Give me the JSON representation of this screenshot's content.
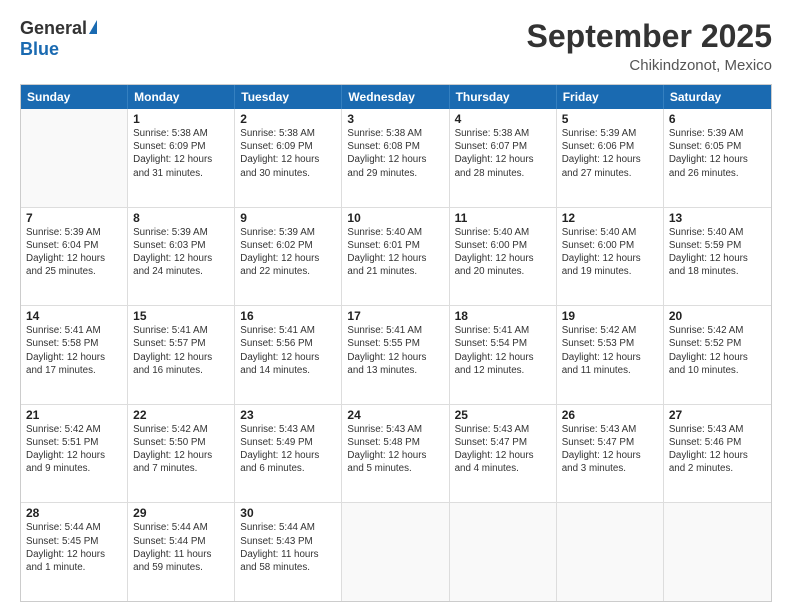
{
  "header": {
    "logo_general": "General",
    "logo_blue": "Blue",
    "month": "September 2025",
    "location": "Chikindzonot, Mexico"
  },
  "calendar": {
    "days_of_week": [
      "Sunday",
      "Monday",
      "Tuesday",
      "Wednesday",
      "Thursday",
      "Friday",
      "Saturday"
    ],
    "rows": [
      [
        {
          "day": "",
          "info": ""
        },
        {
          "day": "1",
          "info": "Sunrise: 5:38 AM\nSunset: 6:09 PM\nDaylight: 12 hours\nand 31 minutes."
        },
        {
          "day": "2",
          "info": "Sunrise: 5:38 AM\nSunset: 6:09 PM\nDaylight: 12 hours\nand 30 minutes."
        },
        {
          "day": "3",
          "info": "Sunrise: 5:38 AM\nSunset: 6:08 PM\nDaylight: 12 hours\nand 29 minutes."
        },
        {
          "day": "4",
          "info": "Sunrise: 5:38 AM\nSunset: 6:07 PM\nDaylight: 12 hours\nand 28 minutes."
        },
        {
          "day": "5",
          "info": "Sunrise: 5:39 AM\nSunset: 6:06 PM\nDaylight: 12 hours\nand 27 minutes."
        },
        {
          "day": "6",
          "info": "Sunrise: 5:39 AM\nSunset: 6:05 PM\nDaylight: 12 hours\nand 26 minutes."
        }
      ],
      [
        {
          "day": "7",
          "info": "Sunrise: 5:39 AM\nSunset: 6:04 PM\nDaylight: 12 hours\nand 25 minutes."
        },
        {
          "day": "8",
          "info": "Sunrise: 5:39 AM\nSunset: 6:03 PM\nDaylight: 12 hours\nand 24 minutes."
        },
        {
          "day": "9",
          "info": "Sunrise: 5:39 AM\nSunset: 6:02 PM\nDaylight: 12 hours\nand 22 minutes."
        },
        {
          "day": "10",
          "info": "Sunrise: 5:40 AM\nSunset: 6:01 PM\nDaylight: 12 hours\nand 21 minutes."
        },
        {
          "day": "11",
          "info": "Sunrise: 5:40 AM\nSunset: 6:00 PM\nDaylight: 12 hours\nand 20 minutes."
        },
        {
          "day": "12",
          "info": "Sunrise: 5:40 AM\nSunset: 6:00 PM\nDaylight: 12 hours\nand 19 minutes."
        },
        {
          "day": "13",
          "info": "Sunrise: 5:40 AM\nSunset: 5:59 PM\nDaylight: 12 hours\nand 18 minutes."
        }
      ],
      [
        {
          "day": "14",
          "info": "Sunrise: 5:41 AM\nSunset: 5:58 PM\nDaylight: 12 hours\nand 17 minutes."
        },
        {
          "day": "15",
          "info": "Sunrise: 5:41 AM\nSunset: 5:57 PM\nDaylight: 12 hours\nand 16 minutes."
        },
        {
          "day": "16",
          "info": "Sunrise: 5:41 AM\nSunset: 5:56 PM\nDaylight: 12 hours\nand 14 minutes."
        },
        {
          "day": "17",
          "info": "Sunrise: 5:41 AM\nSunset: 5:55 PM\nDaylight: 12 hours\nand 13 minutes."
        },
        {
          "day": "18",
          "info": "Sunrise: 5:41 AM\nSunset: 5:54 PM\nDaylight: 12 hours\nand 12 minutes."
        },
        {
          "day": "19",
          "info": "Sunrise: 5:42 AM\nSunset: 5:53 PM\nDaylight: 12 hours\nand 11 minutes."
        },
        {
          "day": "20",
          "info": "Sunrise: 5:42 AM\nSunset: 5:52 PM\nDaylight: 12 hours\nand 10 minutes."
        }
      ],
      [
        {
          "day": "21",
          "info": "Sunrise: 5:42 AM\nSunset: 5:51 PM\nDaylight: 12 hours\nand 9 minutes."
        },
        {
          "day": "22",
          "info": "Sunrise: 5:42 AM\nSunset: 5:50 PM\nDaylight: 12 hours\nand 7 minutes."
        },
        {
          "day": "23",
          "info": "Sunrise: 5:43 AM\nSunset: 5:49 PM\nDaylight: 12 hours\nand 6 minutes."
        },
        {
          "day": "24",
          "info": "Sunrise: 5:43 AM\nSunset: 5:48 PM\nDaylight: 12 hours\nand 5 minutes."
        },
        {
          "day": "25",
          "info": "Sunrise: 5:43 AM\nSunset: 5:47 PM\nDaylight: 12 hours\nand 4 minutes."
        },
        {
          "day": "26",
          "info": "Sunrise: 5:43 AM\nSunset: 5:47 PM\nDaylight: 12 hours\nand 3 minutes."
        },
        {
          "day": "27",
          "info": "Sunrise: 5:43 AM\nSunset: 5:46 PM\nDaylight: 12 hours\nand 2 minutes."
        }
      ],
      [
        {
          "day": "28",
          "info": "Sunrise: 5:44 AM\nSunset: 5:45 PM\nDaylight: 12 hours\nand 1 minute."
        },
        {
          "day": "29",
          "info": "Sunrise: 5:44 AM\nSunset: 5:44 PM\nDaylight: 11 hours\nand 59 minutes."
        },
        {
          "day": "30",
          "info": "Sunrise: 5:44 AM\nSunset: 5:43 PM\nDaylight: 11 hours\nand 58 minutes."
        },
        {
          "day": "",
          "info": ""
        },
        {
          "day": "",
          "info": ""
        },
        {
          "day": "",
          "info": ""
        },
        {
          "day": "",
          "info": ""
        }
      ]
    ]
  }
}
